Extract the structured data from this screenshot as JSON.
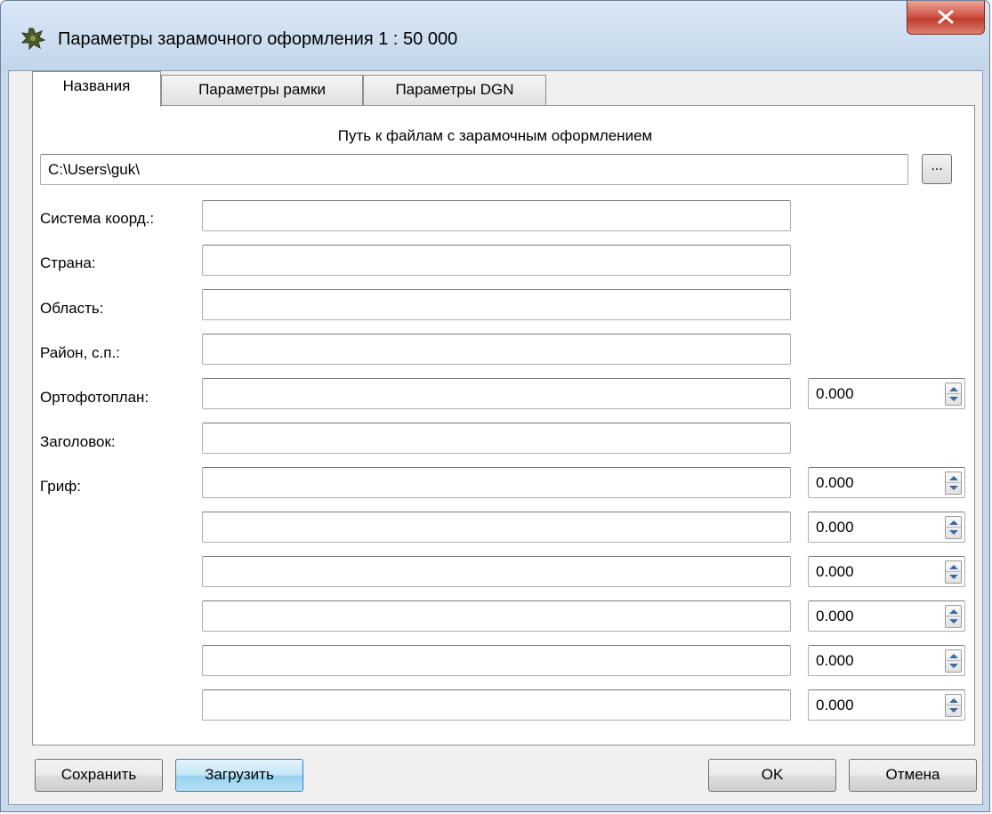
{
  "window": {
    "title": "Параметры зарамочного оформления 1 : 50 000",
    "close_label": "x"
  },
  "tabs": [
    {
      "label": "Названия",
      "active": true
    },
    {
      "label": "Параметры рамки",
      "active": false
    },
    {
      "label": "Параметры DGN",
      "active": false
    }
  ],
  "path_section": {
    "caption": "Путь к файлам с зарамочным оформлением",
    "value": "C:\\Users\\guk\\",
    "browse_label": "..."
  },
  "fields": {
    "coord_system": {
      "label": "Система коорд.:",
      "value": ""
    },
    "country": {
      "label": "Страна:",
      "value": ""
    },
    "region": {
      "label": "Область:",
      "value": ""
    },
    "district": {
      "label": "Район, с.п.:",
      "value": ""
    },
    "orthophoto": {
      "label": "Ортофотоплан:",
      "value": "",
      "number": "0.000"
    },
    "heading": {
      "label": "Заголовок:",
      "value": ""
    },
    "stamp": {
      "label": "Гриф:",
      "rows": [
        {
          "value": "",
          "number": "0.000"
        },
        {
          "value": "",
          "number": "0.000"
        },
        {
          "value": "",
          "number": "0.000"
        },
        {
          "value": "",
          "number": "0.000"
        },
        {
          "value": "",
          "number": "0.000"
        },
        {
          "value": "",
          "number": "0.000"
        }
      ]
    }
  },
  "buttons": {
    "save": "Сохранить",
    "load": "Загрузить",
    "ok": "OK",
    "cancel": "Отмена"
  }
}
